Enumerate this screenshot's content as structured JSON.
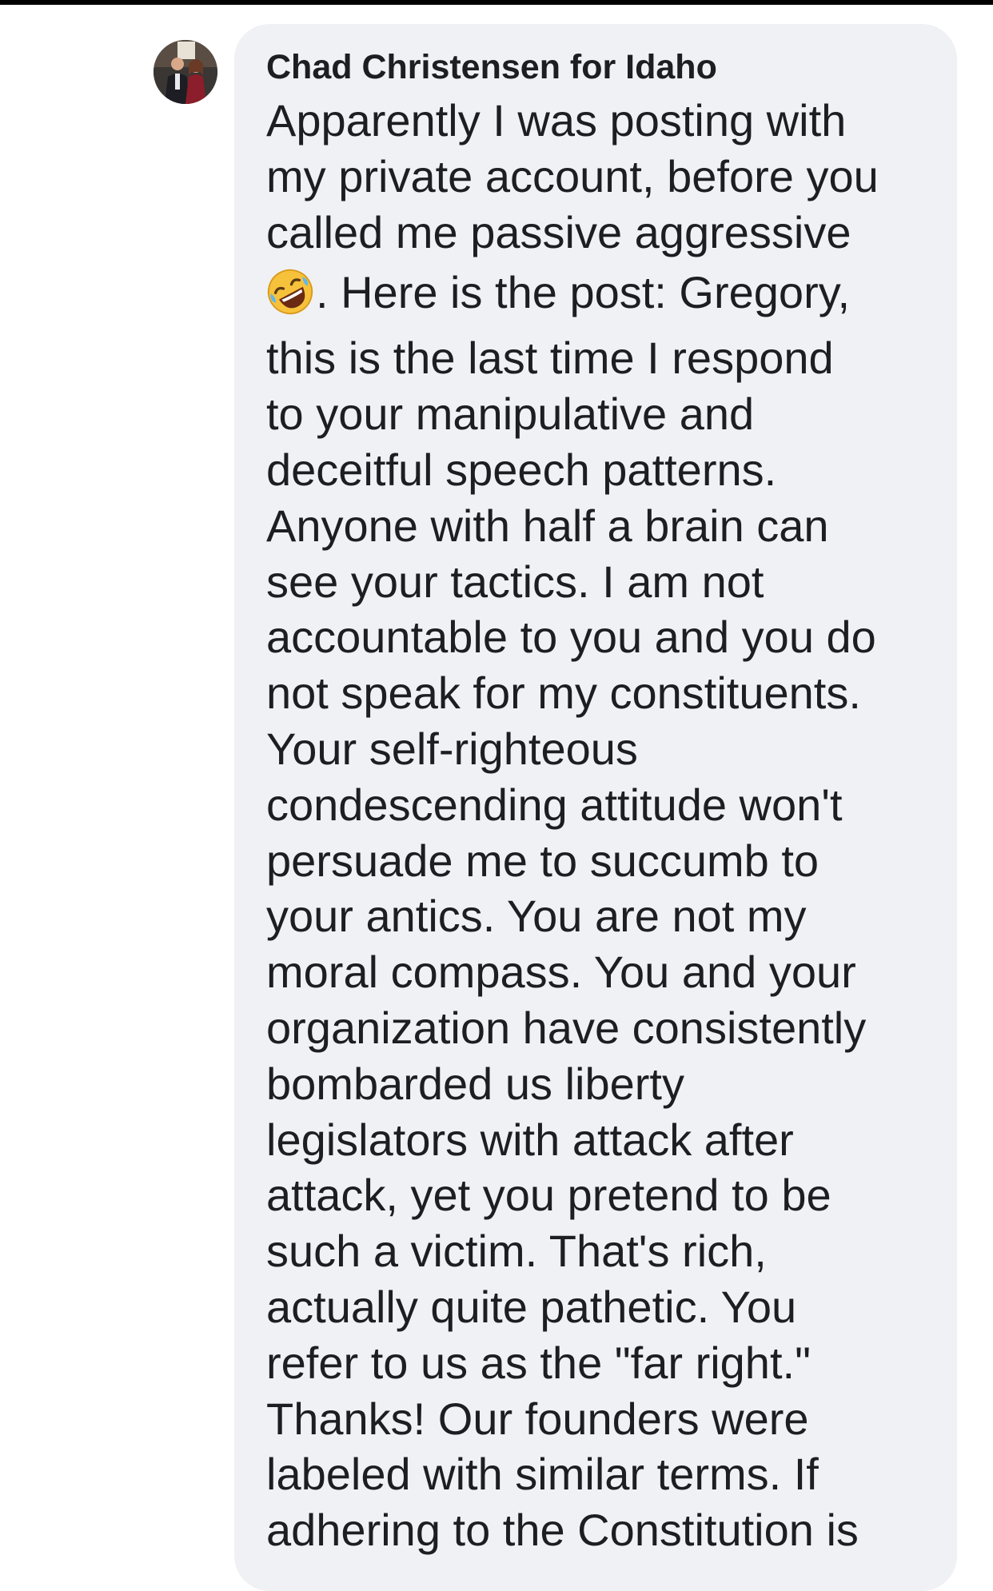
{
  "comment": {
    "author": "Chad Christensen for Idaho",
    "avatar_icon": "profile-photo",
    "emoji_icon": "rolling-on-the-floor-laughing-emoji",
    "lines": [
      "Apparently I was posting with",
      "my private account, before you",
      "called me passive aggressive",
      ". Here is the post: Gregory,",
      "this is the last time I respond",
      "to your manipulative and",
      "deceitful speech patterns.",
      "Anyone with half a brain can",
      "see your tactics. I am not",
      "accountable to you and you do",
      "not speak for my constituents.",
      "Your self-righteous",
      "condescending attitude won't",
      "persuade me to succumb to",
      "your antics. You are not my",
      "moral compass. You and your",
      "organization have consistently",
      "bombarded us liberty",
      "legislators with attack after",
      "attack, yet you pretend to be",
      "such a victim. That's rich,",
      "actually quite pathetic. You",
      "refer to us as the \"far right.\"",
      "Thanks! Our founders were",
      "labeled with similar terms. If",
      "adhering to the Constitution is"
    ]
  },
  "colors": {
    "bubble_background": "#f0f1f4",
    "text": "#1c1e21",
    "emoji_face": "#f7c23b"
  }
}
